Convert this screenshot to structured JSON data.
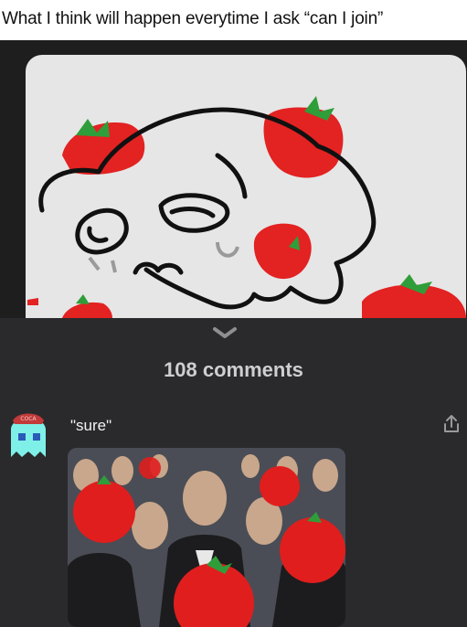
{
  "caption": {
    "text": "What I think will happen everytime I ask “can I join”"
  },
  "post": {
    "image": "cartoon-skull-with-tomatoes-drawing"
  },
  "comments_header": {
    "count_label": "108 comments",
    "expand_icon": "chevron-down-icon"
  },
  "comment": {
    "avatar": "pacman-ghost-avatar",
    "text": "\"sure\"",
    "share_icon": "share-icon",
    "image": "meme-crowd-with-tomatoes"
  },
  "colors": {
    "background": "#232323",
    "sheet": "#2a2a2c",
    "tomato": "#e32222",
    "leaf": "#2f9e3a",
    "avatar_ghost": "#7ff0e8"
  }
}
